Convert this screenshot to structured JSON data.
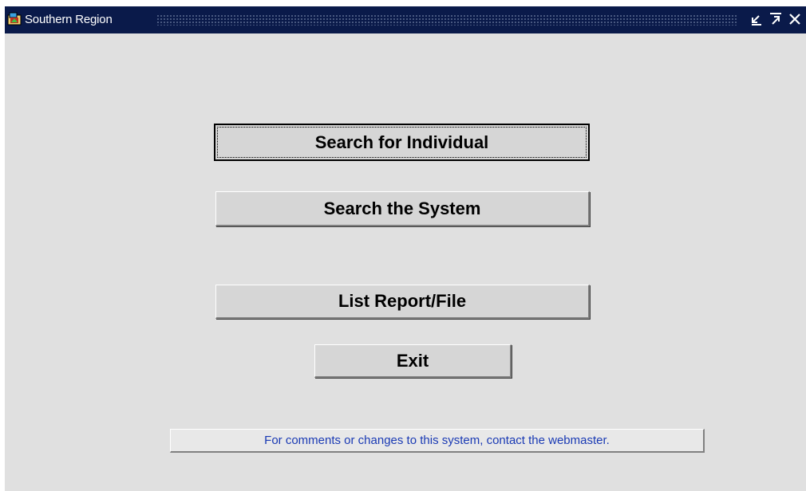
{
  "window": {
    "title": "Southern Region",
    "title_icon": "oracle-forms-app-icon",
    "controls": {
      "minimize_icon": "minimize-icon",
      "maximize_icon": "maximize-icon",
      "close_icon": "close-icon"
    }
  },
  "menu": {
    "search_individual_label": "Search for Individual",
    "search_system_label": "Search the System",
    "list_report_label": "List Report/File",
    "exit_label": "Exit"
  },
  "footer": {
    "contact_label": "For comments or changes to this system, contact the webmaster."
  },
  "colors": {
    "titlebar": "#0a1a4a",
    "background": "#e0e0e0",
    "button_face": "#d6d6d6",
    "link_text": "#1a3ab4"
  }
}
